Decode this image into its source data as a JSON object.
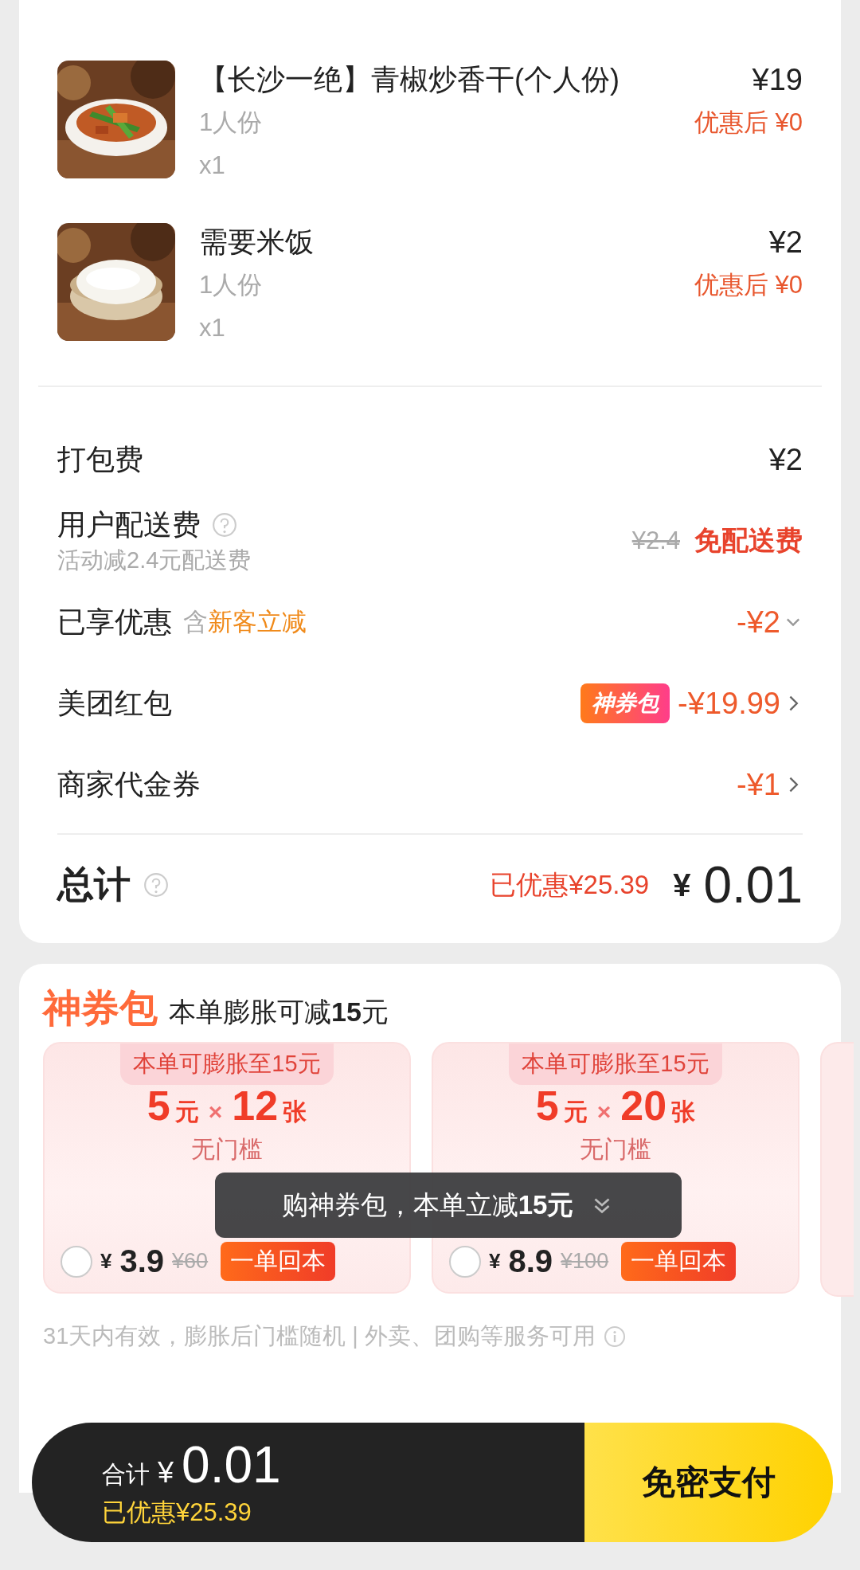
{
  "items": [
    {
      "kind": "stirfry",
      "name": "【长沙一绝】青椒炒香干(个人份)",
      "portion": "1人份",
      "quantity": "x1",
      "price": "¥19",
      "discounted_price": "优惠后 ¥0"
    },
    {
      "kind": "rice",
      "name": "需要米饭",
      "portion": "1人份",
      "quantity": "x1",
      "price": "¥2",
      "discounted_price": "优惠后 ¥0"
    }
  ],
  "fees": [
    {
      "kind": "plain",
      "label": "打包费",
      "value": "¥2"
    },
    {
      "kind": "delivery",
      "label": "用户配送费",
      "help": true,
      "note": "活动减2.4元配送费",
      "original": "¥2.4",
      "value": "免配送费"
    },
    {
      "kind": "discount",
      "label": "已享优惠",
      "tag_prefix": "含",
      "tag": "新客立减",
      "value": "-¥2",
      "chevron": true
    },
    {
      "kind": "badge",
      "label": "美团红包",
      "badge": "神券包",
      "value": "-¥19.99",
      "chevron": true
    },
    {
      "kind": "plain",
      "label": "商家代金券",
      "value": "-¥1",
      "chevron": true
    }
  ],
  "total": {
    "label": "总计",
    "help": true,
    "saved": "已优惠¥25.39",
    "currency": "¥",
    "amount": "0.01"
  },
  "coupon_pack": {
    "title": "神券包",
    "subtitle": "本单膨胀可减**15**元",
    "offers": [
      {
        "ribbon": "本单可膨胀至15元",
        "value": "5",
        "value_unit": "元",
        "multiply_sign": "×",
        "count": "12",
        "count_unit": "张",
        "note": "无门槛",
        "currency": "¥",
        "price": "3.9",
        "original_price": "¥60",
        "tag": "一单回本",
        "selected": false
      },
      {
        "ribbon": "本单可膨胀至15元",
        "value": "5",
        "value_unit": "元",
        "multiply_sign": "×",
        "count": "20",
        "count_unit": "张",
        "note": "无门槛",
        "currency": "¥",
        "price": "8.9",
        "original_price": "¥100",
        "tag": "一单回本",
        "selected": false
      }
    ],
    "toast": "购神券包，本单立减**15元**",
    "footnote": "31天内有效，膨胀后门槛随机 | 外卖、团购等服务可用"
  },
  "pay_bar": {
    "total_label": "合计",
    "currency": "¥",
    "amount": "0.01",
    "saved": "已优惠¥25.39",
    "button": "免密支付"
  }
}
